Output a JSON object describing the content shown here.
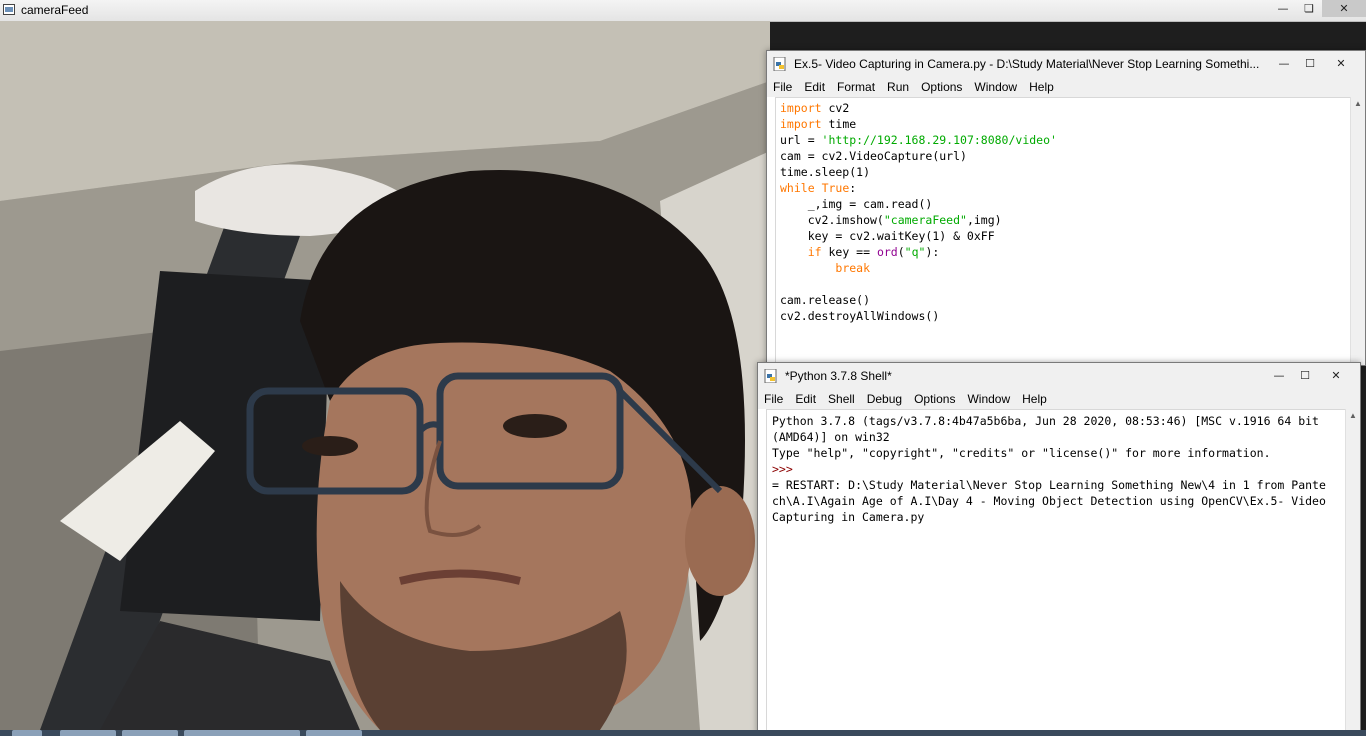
{
  "camera_window": {
    "title": "cameraFeed",
    "controls": {
      "minimize": "—",
      "maximize": "❏",
      "close": "✕"
    }
  },
  "editor_window": {
    "title": "Ex.5- Video Capturing in Camera.py - D:\\Study Material\\Never Stop Learning Somethi...",
    "menu": [
      "File",
      "Edit",
      "Format",
      "Run",
      "Options",
      "Window",
      "Help"
    ],
    "controls": {
      "minimize": "—",
      "maximize": "☐",
      "close": "✕"
    },
    "code_lines": [
      "import cv2",
      "import time",
      "url = 'http://192.168.29.107:8080/video'",
      "cam = cv2.VideoCapture(url)",
      "time.sleep(1)",
      "while True:",
      "    _,img = cam.read()",
      "    cv2.imshow(\"cameraFeed\",img)",
      "    key = cv2.waitKey(1) & 0xFF",
      "    if key == ord(\"q\"):",
      "        break",
      "",
      "cam.release()",
      "cv2.destroyAllWindows()"
    ]
  },
  "shell_window": {
    "title": "*Python 3.7.8 Shell*",
    "menu": [
      "File",
      "Edit",
      "Shell",
      "Debug",
      "Options",
      "Window",
      "Help"
    ],
    "controls": {
      "minimize": "—",
      "maximize": "☐",
      "close": "✕"
    },
    "lines": [
      "Python 3.7.8 (tags/v3.7.8:4b47a5b6ba, Jun 28 2020, 08:53:46) [MSC v.1916 64 bit (AMD64)] on win32",
      "Type \"help\", \"copyright\", \"credits\" or \"license()\" for more information.",
      ">>> ",
      "= RESTART: D:\\Study Material\\Never Stop Learning Something New\\4 in 1 from Pantech\\A.I\\Again Age of A.I\\Day 4 - Moving Object Detection using OpenCV\\Ex.5- Video Capturing in Camera.py"
    ]
  },
  "colors": {
    "keyword": "#ff7700",
    "string": "#00aa00",
    "builtin": "#900090",
    "prompt": "#8b0000"
  }
}
